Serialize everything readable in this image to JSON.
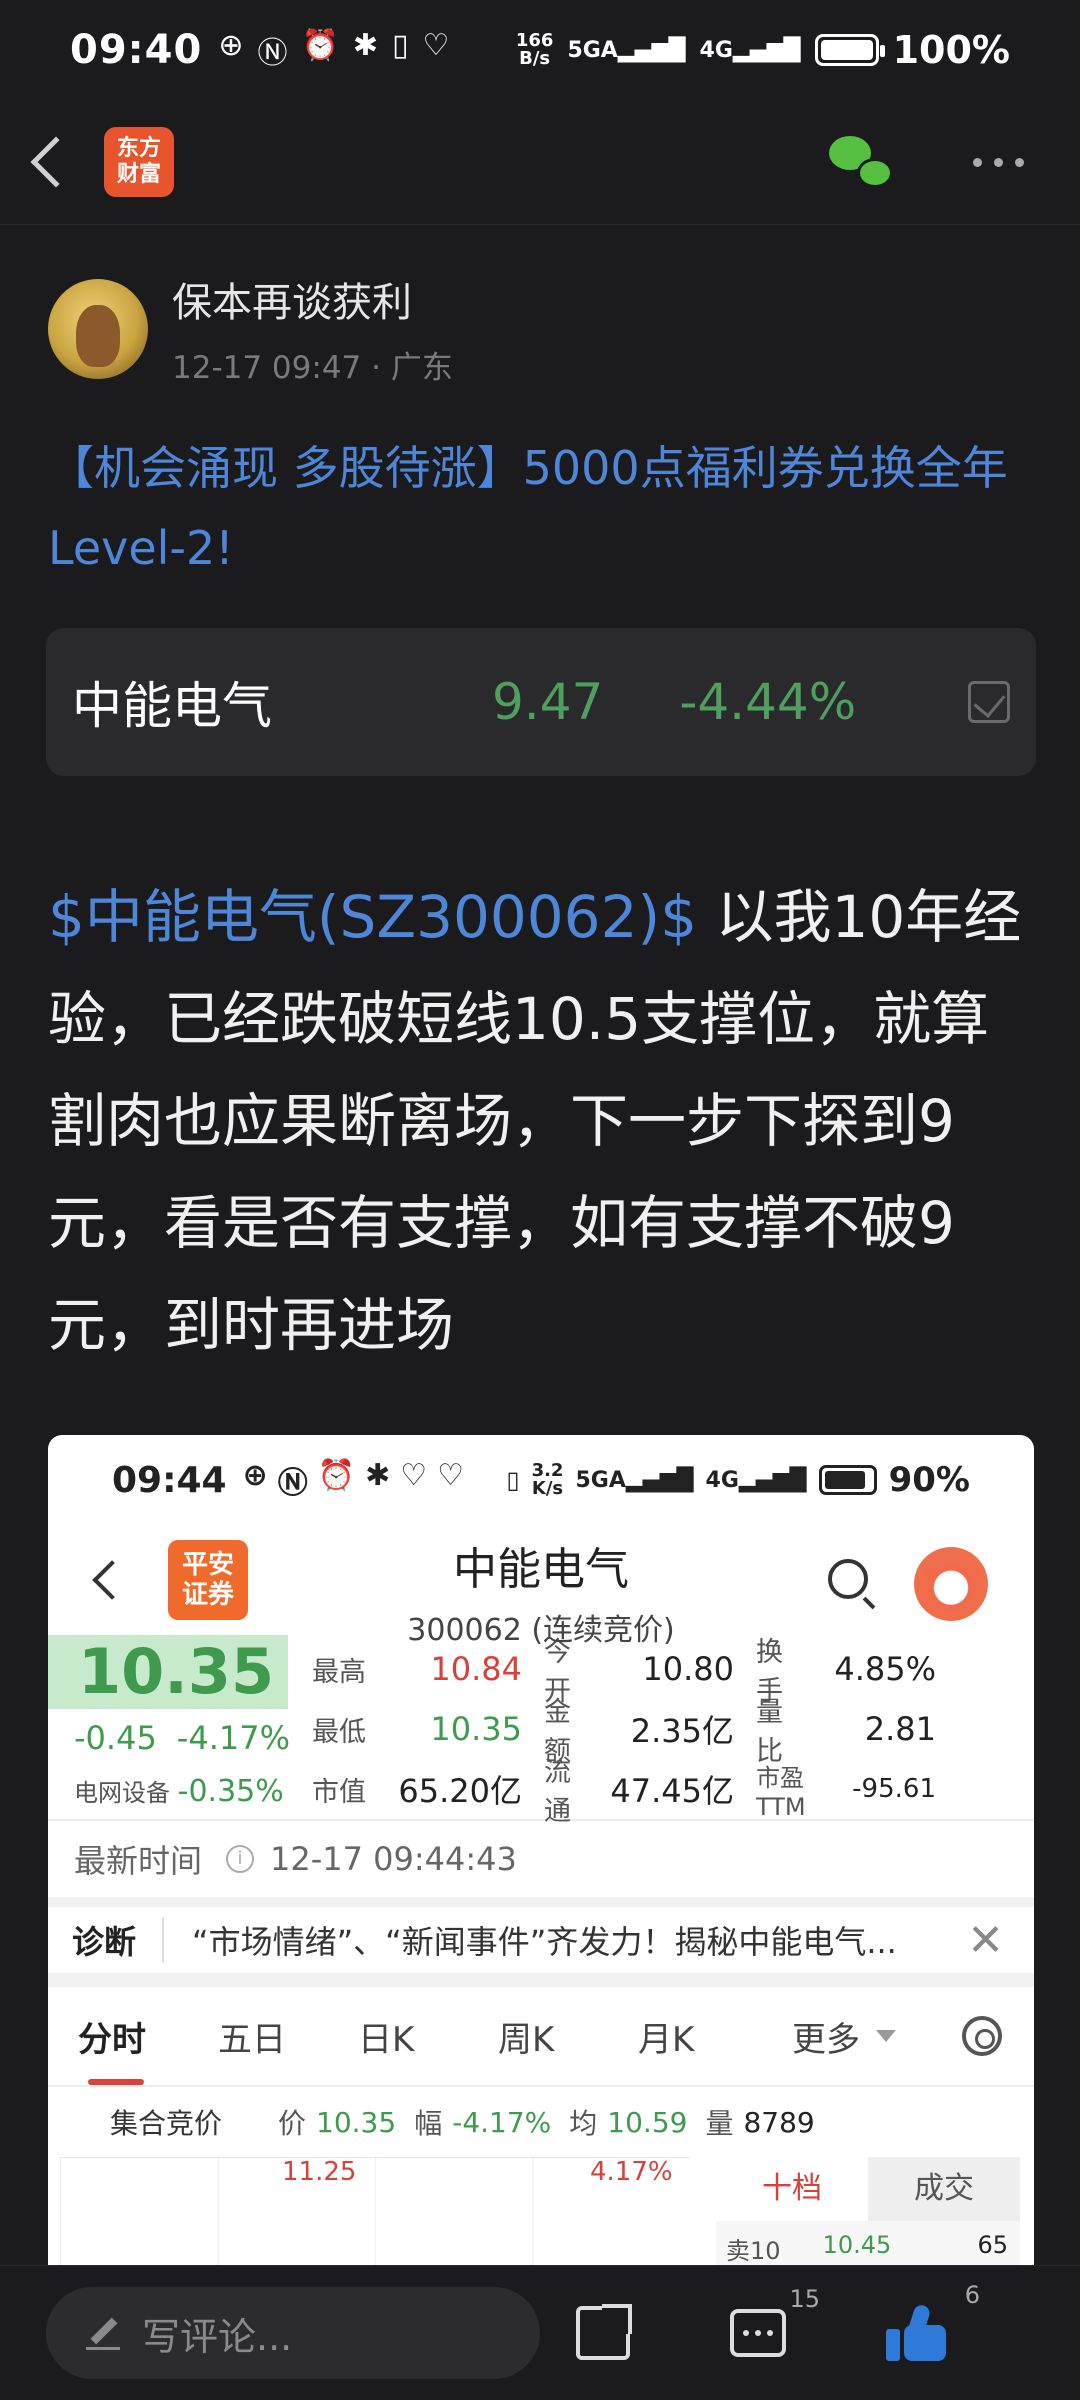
{
  "status_bar": {
    "time": "09:40",
    "net_speed_top": "166",
    "net_speed_bottom": "B/s",
    "sig1": "5GA",
    "sig2": "4G",
    "battery_pct": "100%",
    "battery_level": 1.0
  },
  "app_bar": {
    "logo_line1": "东方",
    "logo_line2": "财富"
  },
  "post": {
    "author": "保本再谈获利",
    "meta": "12-17 09:47  · 广东",
    "promo": "【机会涌现 多股待涨】5000点福利券兑换全年Level-2!",
    "stock_card": {
      "name": "中能电气",
      "price": "9.47",
      "change": "-4.44%"
    },
    "tag": "$中能电气(SZ300062)$",
    "body": " 以我10年经验，已经跌破短线10.5支撑位，就算割肉也应果断离场，下一步下探到9元，看是否有支撑，如有支撑不破9元，到时再进场"
  },
  "shot": {
    "status": {
      "time": "09:44",
      "rate_top": "3.2",
      "rate_bottom": "K/s",
      "sig1": "5GA",
      "sig2": "4G",
      "battery_pct": "90%",
      "battery_level": 0.9
    },
    "logo_line1": "平安",
    "logo_line2": "证券",
    "title": "中能电气",
    "subtitle": "300062 (连续竞价)",
    "quote": {
      "price": "10.35",
      "change": "-0.45",
      "change_pct": "-4.17%",
      "sector_label": "电网设备",
      "sector_pct": "-0.35%",
      "rows": [
        [
          "最高",
          "10.84",
          "今开",
          "10.80",
          "换手",
          "4.85%"
        ],
        [
          "最低",
          "10.35",
          "金额",
          "2.35亿",
          "量比",
          "2.81"
        ],
        [
          "市值",
          "65.20亿",
          "流通",
          "47.45亿",
          "市盈TTM",
          "-95.61"
        ]
      ]
    },
    "update_label": "最新时间",
    "update_time": "12-17 09:44:43",
    "diag_label": "诊断",
    "diag_text": "“市场情绪”、“新闻事件”齐发力！揭秘中能电气...",
    "tabs": [
      "分时",
      "五日",
      "日K",
      "周K",
      "月K"
    ],
    "more_tab": "更多",
    "auction": {
      "label": "集合竞价",
      "price_k": "价",
      "price_v": "10.35",
      "amp_k": "幅",
      "amp_v": "-4.17%",
      "avg_k": "均",
      "avg_v": "10.59",
      "vol_k": "量",
      "vol_v": "8789"
    },
    "chart": {
      "high": "11.25",
      "high_pct": "4.17%"
    },
    "order_book": {
      "tab1": "十档",
      "tab2": "成交",
      "row_label": "卖10",
      "row_price": "10.45",
      "row_qty": "65"
    }
  },
  "bottom_bar": {
    "comment_placeholder": "写评论...",
    "comment_count": "15",
    "like_count": "6"
  }
}
